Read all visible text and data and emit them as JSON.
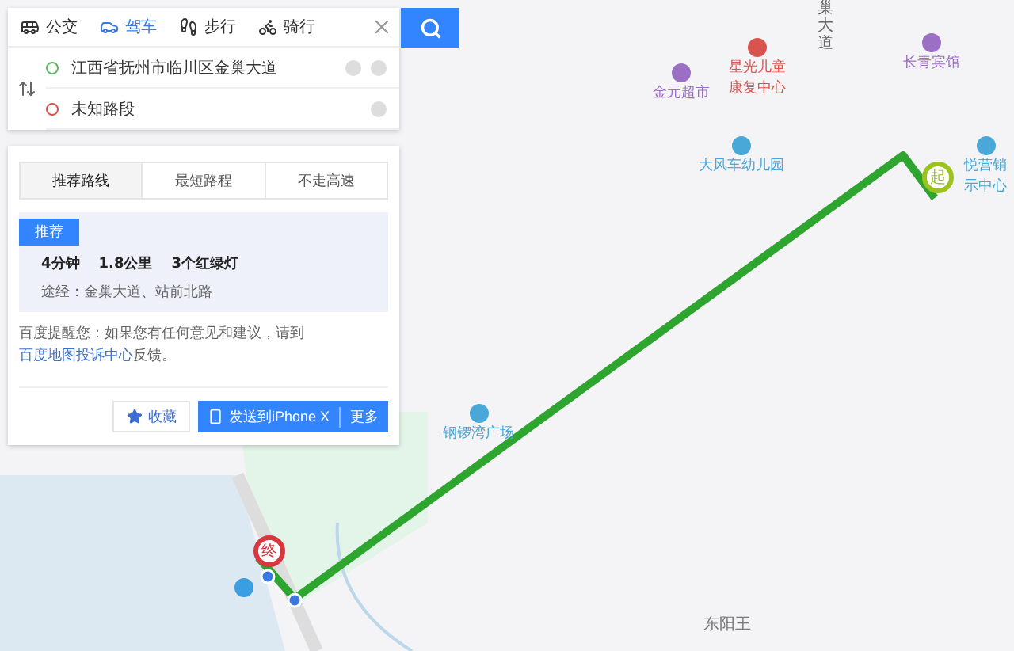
{
  "modes": [
    {
      "label": "公交",
      "kind": "bus",
      "selected": false
    },
    {
      "label": "驾车",
      "kind": "car",
      "selected": true
    },
    {
      "label": "步行",
      "kind": "walk",
      "selected": false
    },
    {
      "label": "骑行",
      "kind": "bike",
      "selected": false
    }
  ],
  "stops": [
    {
      "value": "江西省抚州市临川区金巢大道",
      "kind": "start",
      "add": true
    },
    {
      "value": "未知路段",
      "kind": "end",
      "add": false
    }
  ],
  "route_tabs": [
    {
      "label": "推荐路线",
      "selected": true
    },
    {
      "label": "最短路程",
      "selected": false
    },
    {
      "label": "不走高速",
      "selected": false
    }
  ],
  "route": {
    "badge": "推荐",
    "stats": [
      "4分钟",
      "1.8公里",
      "3个红绿灯"
    ],
    "via": "途经：金巢大道、站前北路"
  },
  "tip": {
    "text": "百度提醒您：如果您有任何意见和建议，请到",
    "link": "百度地图投诉中心",
    "after": "反馈。"
  },
  "actions": {
    "favorite": "收藏",
    "send": "发送到iPhone X",
    "more": "更多"
  },
  "map": {
    "pins": [
      {
        "label": "起",
        "kind": "start"
      },
      {
        "label": "终",
        "kind": "end"
      }
    ],
    "places": [
      {
        "lines": [
          "金元超市"
        ],
        "color": "#9b6fc4"
      },
      {
        "lines": [
          "星光儿童",
          "康复中心"
        ],
        "color": "#d9534f"
      },
      {
        "lines": [
          "长青宾馆"
        ],
        "color": "#9b6fc4"
      },
      {
        "lines": [
          "大风车幼儿园"
        ],
        "color": "#4aa8d8"
      },
      {
        "lines": [
          "悦营销",
          "示中心"
        ],
        "color": "#4aa8d8"
      },
      {
        "lines": [
          "钢锣湾广场"
        ],
        "color": "#4aa8d8"
      }
    ],
    "road": "巢大道",
    "village": "东阳王"
  }
}
